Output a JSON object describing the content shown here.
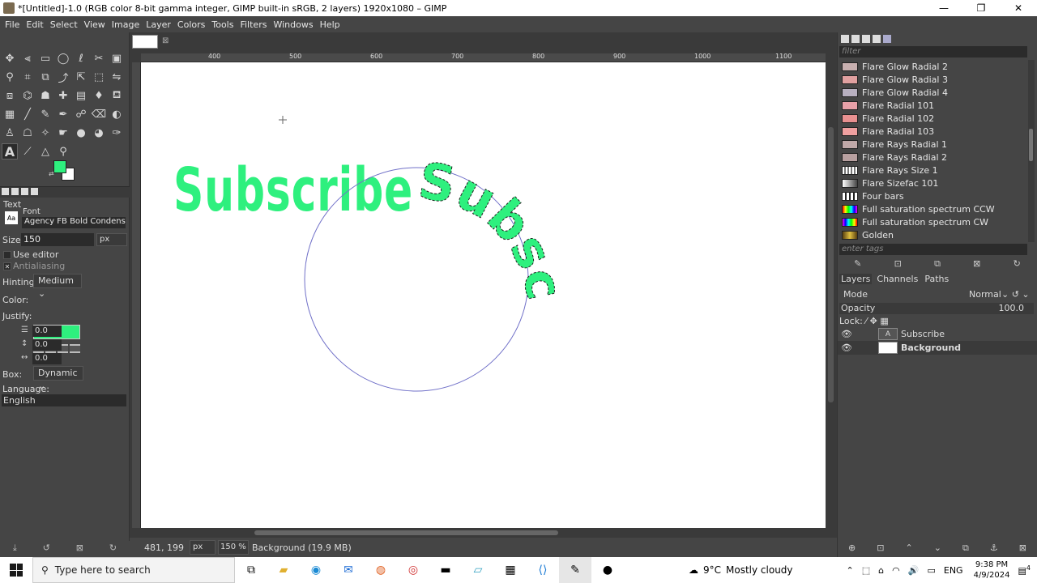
{
  "window": {
    "title": "*[Untitled]-1.0 (RGB color 8-bit gamma integer, GIMP built-in sRGB, 2 layers) 1920x1080 – GIMP",
    "minimize": "—",
    "maximize": "❐",
    "close": "✕"
  },
  "menu": [
    "File",
    "Edit",
    "Select",
    "View",
    "Image",
    "Layer",
    "Colors",
    "Tools",
    "Filters",
    "Windows",
    "Help"
  ],
  "toolbox": {
    "foreground_color": "#2ef07e",
    "background_color": "#ffffff",
    "tools": [
      "move-icon",
      "align-icon",
      "rect-select-icon",
      "ellipse-select-icon",
      "free-select-icon",
      "scissors-icon",
      "fuzzy-select-icon",
      "crop-icon",
      "unified-transform-icon",
      "warp-icon",
      "handle-transform-icon",
      "cage-icon",
      "flip-icon",
      "perspective-icon",
      "text-icon",
      "color-picker-icon",
      "measure-icon",
      "zoom-icon"
    ]
  },
  "tool_options": {
    "tool_name": "Text",
    "font_label": "Font",
    "font_value": "Agency FB Bold Condensed",
    "size_label": "Size:",
    "size_value": "150",
    "size_unit": "px",
    "use_editor": "Use editor",
    "antialiasing": "Antialiasing",
    "hinting_label": "Hinting:",
    "hinting_value": "Medium",
    "color_label": "Color:",
    "justify_label": "Justify:",
    "indent_value": "0.0",
    "line_spacing_value": "0.0",
    "letter_spacing_value": "0.0",
    "box_label": "Box:",
    "box_value": "Dynamic",
    "language_label": "Language:",
    "language_value": "English"
  },
  "canvas": {
    "ruler_ticks": [
      "400",
      "500",
      "600",
      "700",
      "800",
      "900",
      "1000",
      "1100"
    ],
    "text_layer": "Subscribe",
    "curved_text": "Subscribe",
    "text_color": "#2ef07e"
  },
  "status": {
    "coords": "481, 199",
    "unit": "px",
    "zoom": "150 %",
    "layer_info": "Background (19.9 MB)"
  },
  "gradients": {
    "filter_placeholder": "filter",
    "tags_placeholder": "enter tags",
    "items": [
      {
        "label": "Flare Glow Radial 2",
        "color": "#c8b0b0"
      },
      {
        "label": "Flare Glow Radial 3",
        "color": "#e0a0a0"
      },
      {
        "label": "Flare Glow Radial 4",
        "color": "#b8b0c0"
      },
      {
        "label": "Flare Radial 101",
        "color": "#e8a0a8"
      },
      {
        "label": "Flare Radial 102",
        "color": "#e89090"
      },
      {
        "label": "Flare Radial 103",
        "color": "#f0a0a0"
      },
      {
        "label": "Flare Rays Radial 1",
        "color": "#c0a8a8"
      },
      {
        "label": "Flare Rays Radial 2",
        "color": "#b8a0a0"
      },
      {
        "label": "Flare Rays Size 1",
        "color": "#d0d0d0"
      },
      {
        "label": "Flare Sizefac 101",
        "color": "#909090"
      },
      {
        "label": "Four bars",
        "color": "#e8e8e8"
      },
      {
        "label": "Full saturation spectrum CCW",
        "color": "#ff00ff"
      },
      {
        "label": "Full saturation spectrum CW",
        "color": "#00ff00"
      },
      {
        "label": "Golden",
        "color": "#c8a030"
      }
    ]
  },
  "layers_panel": {
    "tabs": [
      "Layers",
      "Channels",
      "Paths"
    ],
    "mode_label": "Mode",
    "mode_value": "Normal",
    "opacity_label": "Opacity",
    "opacity_value": "100.0",
    "lock_label": "Lock:",
    "layers": [
      {
        "name": "Subscribe",
        "bold": false
      },
      {
        "name": "Background",
        "bold": true
      }
    ]
  },
  "taskbar": {
    "search_placeholder": "Type here to search",
    "weather_temp": "9°C",
    "weather_desc": "Mostly cloudy",
    "language": "ENG",
    "time": "9:38 PM",
    "date": "4/9/2024",
    "notification_count": "4"
  }
}
